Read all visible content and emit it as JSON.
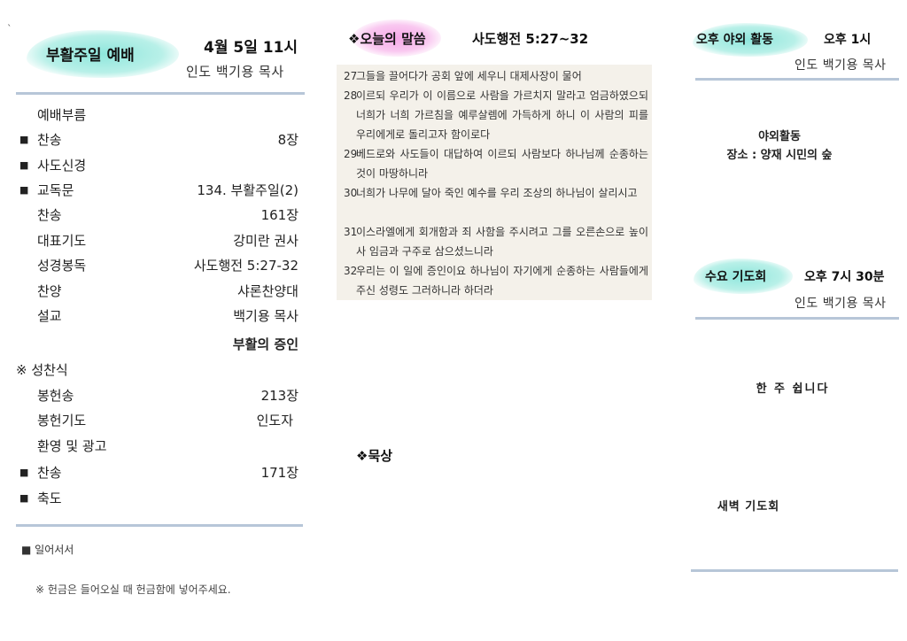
{
  "stray_mark": "`",
  "left": {
    "title": "부활주일 예배",
    "date_time": "4월 5일 11시",
    "leader": "인도 백기용 목사",
    "order": [
      {
        "bullet": "",
        "item": "예배부름",
        "value": ""
      },
      {
        "bullet": "■",
        "item": "찬송",
        "value": "8장"
      },
      {
        "bullet": "■",
        "item": "사도신경",
        "value": ""
      },
      {
        "bullet": "■",
        "item": "교독문",
        "value": "134. 부활주일(2)"
      },
      {
        "bullet": "",
        "item": "찬송",
        "value": "161장"
      },
      {
        "bullet": "",
        "item": "대표기도",
        "value": "강미란 권사"
      },
      {
        "bullet": "",
        "item": "성경봉독",
        "value": "사도행전 5:27-32"
      },
      {
        "bullet": "",
        "item": "찬양",
        "value": "샤론찬양대"
      },
      {
        "bullet": "",
        "item": "설교",
        "value": "백기용 목사"
      },
      {
        "bullet": "",
        "item": "",
        "value": "부활의 증인"
      },
      {
        "bullet": "",
        "item": "※ 성찬식",
        "value": ""
      },
      {
        "bullet": "",
        "item": "봉헌송",
        "value": "213장"
      },
      {
        "bullet": "",
        "item": "봉헌기도",
        "value": "인도자"
      },
      {
        "bullet": "",
        "item": "환영 및 광고",
        "value": ""
      },
      {
        "bullet": "■",
        "item": "찬송",
        "value": "171장"
      },
      {
        "bullet": "■",
        "item": "축도",
        "value": ""
      }
    ],
    "standing_note": "■ 일어서서",
    "offering_note": "※ 헌금은 들어오실 때 헌금함에 넣어주세요."
  },
  "middle": {
    "word_title": "❖오늘의 말씀",
    "reference": "사도행전 5:27~32",
    "verses": [
      {
        "num": "27",
        "text": "그들을 끌어다가 공회 앞에 세우니 대제사장이 물어"
      },
      {
        "num": "28",
        "text": "이르되 우리가 이 이름으로 사람을 가르치지 말라고 엄금하였으되 너희가 너희 가르침을 예루살렘에 가득하게 하니 이 사람의 피를 우리에게로 돌리고자 함이로다"
      },
      {
        "num": "29",
        "text": "베드로와 사도들이 대답하여 이르되 사람보다 하나님께 순종하는 것이 마땅하니라"
      },
      {
        "num": "30",
        "text": "너희가 나무에 달아 죽인 예수를 우리 조상의 하나님이 살리시고"
      },
      {
        "num": "31",
        "text": "이스라엘에게 회개함과 죄 사함을 주시려고 그를 오른손으로 높이사 임금과 구주로 삼으셨느니라"
      },
      {
        "num": "32",
        "text": "우리는 이 일에 증인이요 하나님이 자기에게 순종하는 사람들에게 주신 성령도 그러하니라 하더라"
      }
    ],
    "meditation_title": "❖묵상"
  },
  "right": {
    "outdoor_title": "오후 야외 활동",
    "outdoor_time": "오후 1시",
    "outdoor_leader": "인도 백기용 목사",
    "outdoor_label": "야외활동",
    "outdoor_place": "장소 : 양재 시민의 숲",
    "wed_title": "수요 기도회",
    "wed_time": "오후 7시 30분",
    "wed_leader": "인도 백기용 목사",
    "wed_note": "한 주 쉽니다",
    "dawn_title": "새벽 기도회"
  }
}
